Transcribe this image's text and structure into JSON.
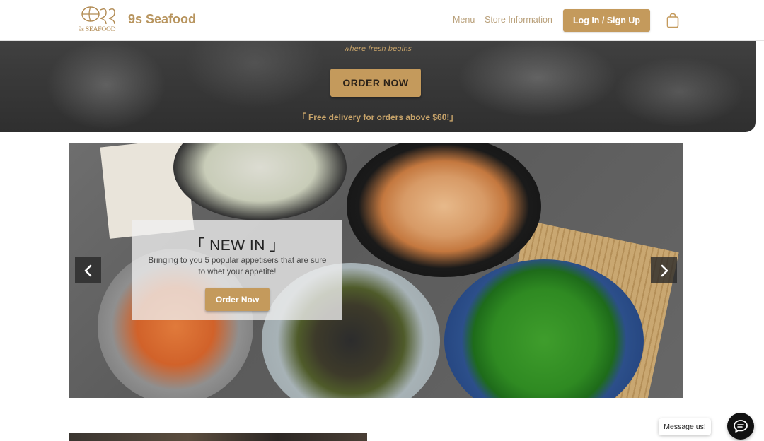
{
  "header": {
    "logo_text": "9s SEAFOOD",
    "brand_name": "9s Seafood",
    "nav": {
      "menu": "Menu",
      "store_info": "Store Information"
    },
    "login_label": "Log In / Sign Up",
    "cart_icon": "shopping-bag-icon"
  },
  "hero": {
    "tagline": "where fresh begins",
    "order_button": "ORDER NOW",
    "delivery_note": "「 Free delivery for orders above $60!」"
  },
  "carousel": {
    "slide": {
      "title": "「 NEW IN 」",
      "description": "Bringing to you 5 popular appetisers that are sure to whet your appetite!",
      "button": "Order Now"
    },
    "prev_icon": "chevron-left-icon",
    "next_icon": "chevron-right-icon"
  },
  "chat": {
    "bubble_text": "Message us!",
    "icon": "chat-icon"
  },
  "colors": {
    "accent_gold": "#c49a5c",
    "brand_text": "#b8955f",
    "nav_text": "#b9a07a",
    "dark_overlay": "#3b3b3b"
  }
}
